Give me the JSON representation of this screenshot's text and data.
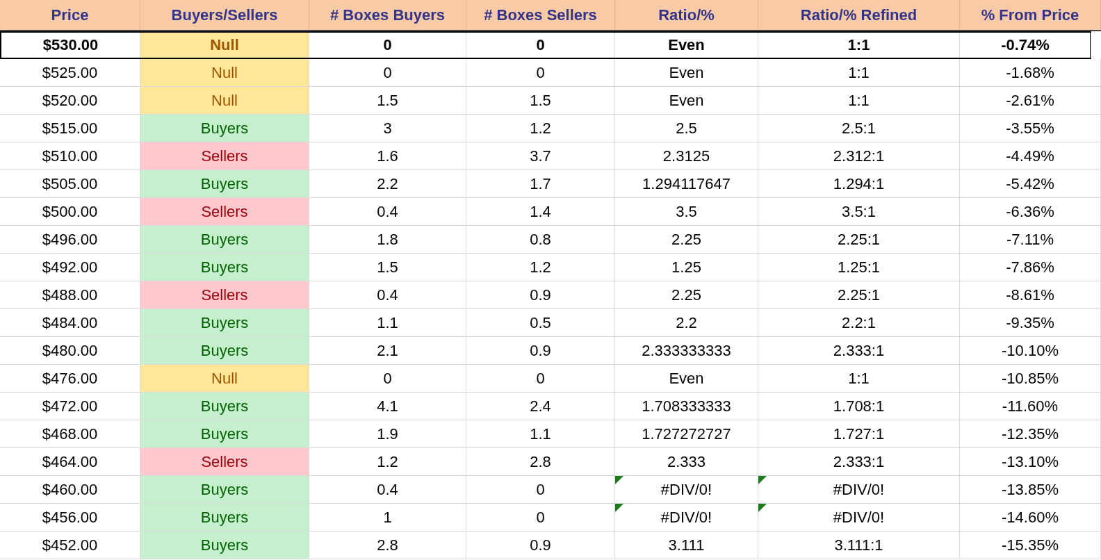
{
  "columns": [
    "Price",
    "Buyers/Sellers",
    "# Boxes Buyers",
    "# Boxes Sellers",
    "Ratio/%",
    "Ratio/% Refined",
    "% From Price"
  ],
  "rows": [
    {
      "price": "$530.00",
      "status": "Null",
      "kind": "null",
      "buyers": "0",
      "sellers": "0",
      "ratio": "Even",
      "refined": "1:1",
      "from_price": "-0.74%",
      "emphasized": true,
      "error_flag": false
    },
    {
      "price": "$525.00",
      "status": "Null",
      "kind": "null",
      "buyers": "0",
      "sellers": "0",
      "ratio": "Even",
      "refined": "1:1",
      "from_price": "-1.68%",
      "emphasized": false,
      "error_flag": false
    },
    {
      "price": "$520.00",
      "status": "Null",
      "kind": "null",
      "buyers": "1.5",
      "sellers": "1.5",
      "ratio": "Even",
      "refined": "1:1",
      "from_price": "-2.61%",
      "emphasized": false,
      "error_flag": false
    },
    {
      "price": "$515.00",
      "status": "Buyers",
      "kind": "buyers",
      "buyers": "3",
      "sellers": "1.2",
      "ratio": "2.5",
      "refined": "2.5:1",
      "from_price": "-3.55%",
      "emphasized": false,
      "error_flag": false
    },
    {
      "price": "$510.00",
      "status": "Sellers",
      "kind": "sellers",
      "buyers": "1.6",
      "sellers": "3.7",
      "ratio": "2.3125",
      "refined": "2.312:1",
      "from_price": "-4.49%",
      "emphasized": false,
      "error_flag": false
    },
    {
      "price": "$505.00",
      "status": "Buyers",
      "kind": "buyers",
      "buyers": "2.2",
      "sellers": "1.7",
      "ratio": "1.294117647",
      "refined": "1.294:1",
      "from_price": "-5.42%",
      "emphasized": false,
      "error_flag": false
    },
    {
      "price": "$500.00",
      "status": "Sellers",
      "kind": "sellers",
      "buyers": "0.4",
      "sellers": "1.4",
      "ratio": "3.5",
      "refined": "3.5:1",
      "from_price": "-6.36%",
      "emphasized": false,
      "error_flag": false
    },
    {
      "price": "$496.00",
      "status": "Buyers",
      "kind": "buyers",
      "buyers": "1.8",
      "sellers": "0.8",
      "ratio": "2.25",
      "refined": "2.25:1",
      "from_price": "-7.11%",
      "emphasized": false,
      "error_flag": false
    },
    {
      "price": "$492.00",
      "status": "Buyers",
      "kind": "buyers",
      "buyers": "1.5",
      "sellers": "1.2",
      "ratio": "1.25",
      "refined": "1.25:1",
      "from_price": "-7.86%",
      "emphasized": false,
      "error_flag": false
    },
    {
      "price": "$488.00",
      "status": "Sellers",
      "kind": "sellers",
      "buyers": "0.4",
      "sellers": "0.9",
      "ratio": "2.25",
      "refined": "2.25:1",
      "from_price": "-8.61%",
      "emphasized": false,
      "error_flag": false
    },
    {
      "price": "$484.00",
      "status": "Buyers",
      "kind": "buyers",
      "buyers": "1.1",
      "sellers": "0.5",
      "ratio": "2.2",
      "refined": "2.2:1",
      "from_price": "-9.35%",
      "emphasized": false,
      "error_flag": false
    },
    {
      "price": "$480.00",
      "status": "Buyers",
      "kind": "buyers",
      "buyers": "2.1",
      "sellers": "0.9",
      "ratio": "2.333333333",
      "refined": "2.333:1",
      "from_price": "-10.10%",
      "emphasized": false,
      "error_flag": false
    },
    {
      "price": "$476.00",
      "status": "Null",
      "kind": "null",
      "buyers": "0",
      "sellers": "0",
      "ratio": "Even",
      "refined": "1:1",
      "from_price": "-10.85%",
      "emphasized": false,
      "error_flag": false
    },
    {
      "price": "$472.00",
      "status": "Buyers",
      "kind": "buyers",
      "buyers": "4.1",
      "sellers": "2.4",
      "ratio": "1.708333333",
      "refined": "1.708:1",
      "from_price": "-11.60%",
      "emphasized": false,
      "error_flag": false
    },
    {
      "price": "$468.00",
      "status": "Buyers",
      "kind": "buyers",
      "buyers": "1.9",
      "sellers": "1.1",
      "ratio": "1.727272727",
      "refined": "1.727:1",
      "from_price": "-12.35%",
      "emphasized": false,
      "error_flag": false
    },
    {
      "price": "$464.00",
      "status": "Sellers",
      "kind": "sellers",
      "buyers": "1.2",
      "sellers": "2.8",
      "ratio": "2.333",
      "refined": "2.333:1",
      "from_price": "-13.10%",
      "emphasized": false,
      "error_flag": false
    },
    {
      "price": "$460.00",
      "status": "Buyers",
      "kind": "buyers",
      "buyers": "0.4",
      "sellers": "0",
      "ratio": "#DIV/0!",
      "refined": "#DIV/0!",
      "from_price": "-13.85%",
      "emphasized": false,
      "error_flag": true
    },
    {
      "price": "$456.00",
      "status": "Buyers",
      "kind": "buyers",
      "buyers": "1",
      "sellers": "0",
      "ratio": "#DIV/0!",
      "refined": "#DIV/0!",
      "from_price": "-14.60%",
      "emphasized": false,
      "error_flag": true
    },
    {
      "price": "$452.00",
      "status": "Buyers",
      "kind": "buyers",
      "buyers": "2.8",
      "sellers": "0.9",
      "ratio": "3.111",
      "refined": "3.111:1",
      "from_price": "-15.35%",
      "emphasized": false,
      "error_flag": false
    }
  ]
}
